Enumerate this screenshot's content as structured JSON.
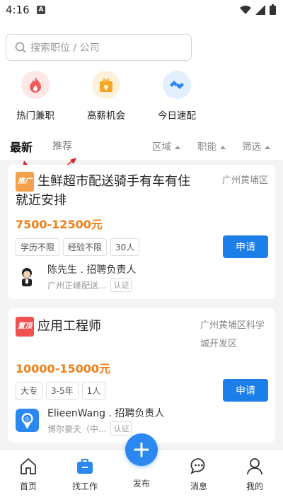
{
  "status_bar": {
    "time": "4:16"
  },
  "search": {
    "placeholder": "搜索职位 / 公司"
  },
  "quick_links": [
    {
      "label": "热门兼职",
      "icon": "flame-icon",
      "color": "#f05a5a"
    },
    {
      "label": "高薪机会",
      "icon": "moneybag-icon",
      "color": "#f5a623"
    },
    {
      "label": "今日速配",
      "icon": "link-icon",
      "color": "#2a88f0"
    }
  ],
  "tabs": {
    "latest": "最新",
    "recommend": "推荐"
  },
  "filters": [
    "区域",
    "职能",
    "筛选"
  ],
  "jobs": [
    {
      "badge": "推广",
      "title_line1": "生鲜超市配送骑手有车有住",
      "title_line2": "就近安排",
      "location": "广州黄埔区",
      "salary": "7500-12500元",
      "tags": [
        "学历不限",
        "经验不限",
        "30人"
      ],
      "apply_label": "申请",
      "contact": "陈先生 . 招聘负责人",
      "company": "广州正峰配送...",
      "verify": "认证"
    },
    {
      "badge": "置顶",
      "title_line1": "应用工程师",
      "location_line1": "广州黄埔区科学",
      "location_line2": "城开发区",
      "salary": "10000-15000元",
      "tags": [
        "大专",
        "3-5年",
        "1人"
      ],
      "apply_label": "申请",
      "contact": "ElieenWang . 招聘负责人",
      "company": "博尔豪夫（中...",
      "verify": "认证"
    }
  ],
  "bottom_nav": [
    "首页",
    "找工作",
    "发布",
    "消息",
    "我的"
  ],
  "colors": {
    "accent": "#1c7ee8",
    "salary": "#f07f19",
    "badge_promo": "#f5a04a",
    "badge_top": "#f0524f"
  }
}
